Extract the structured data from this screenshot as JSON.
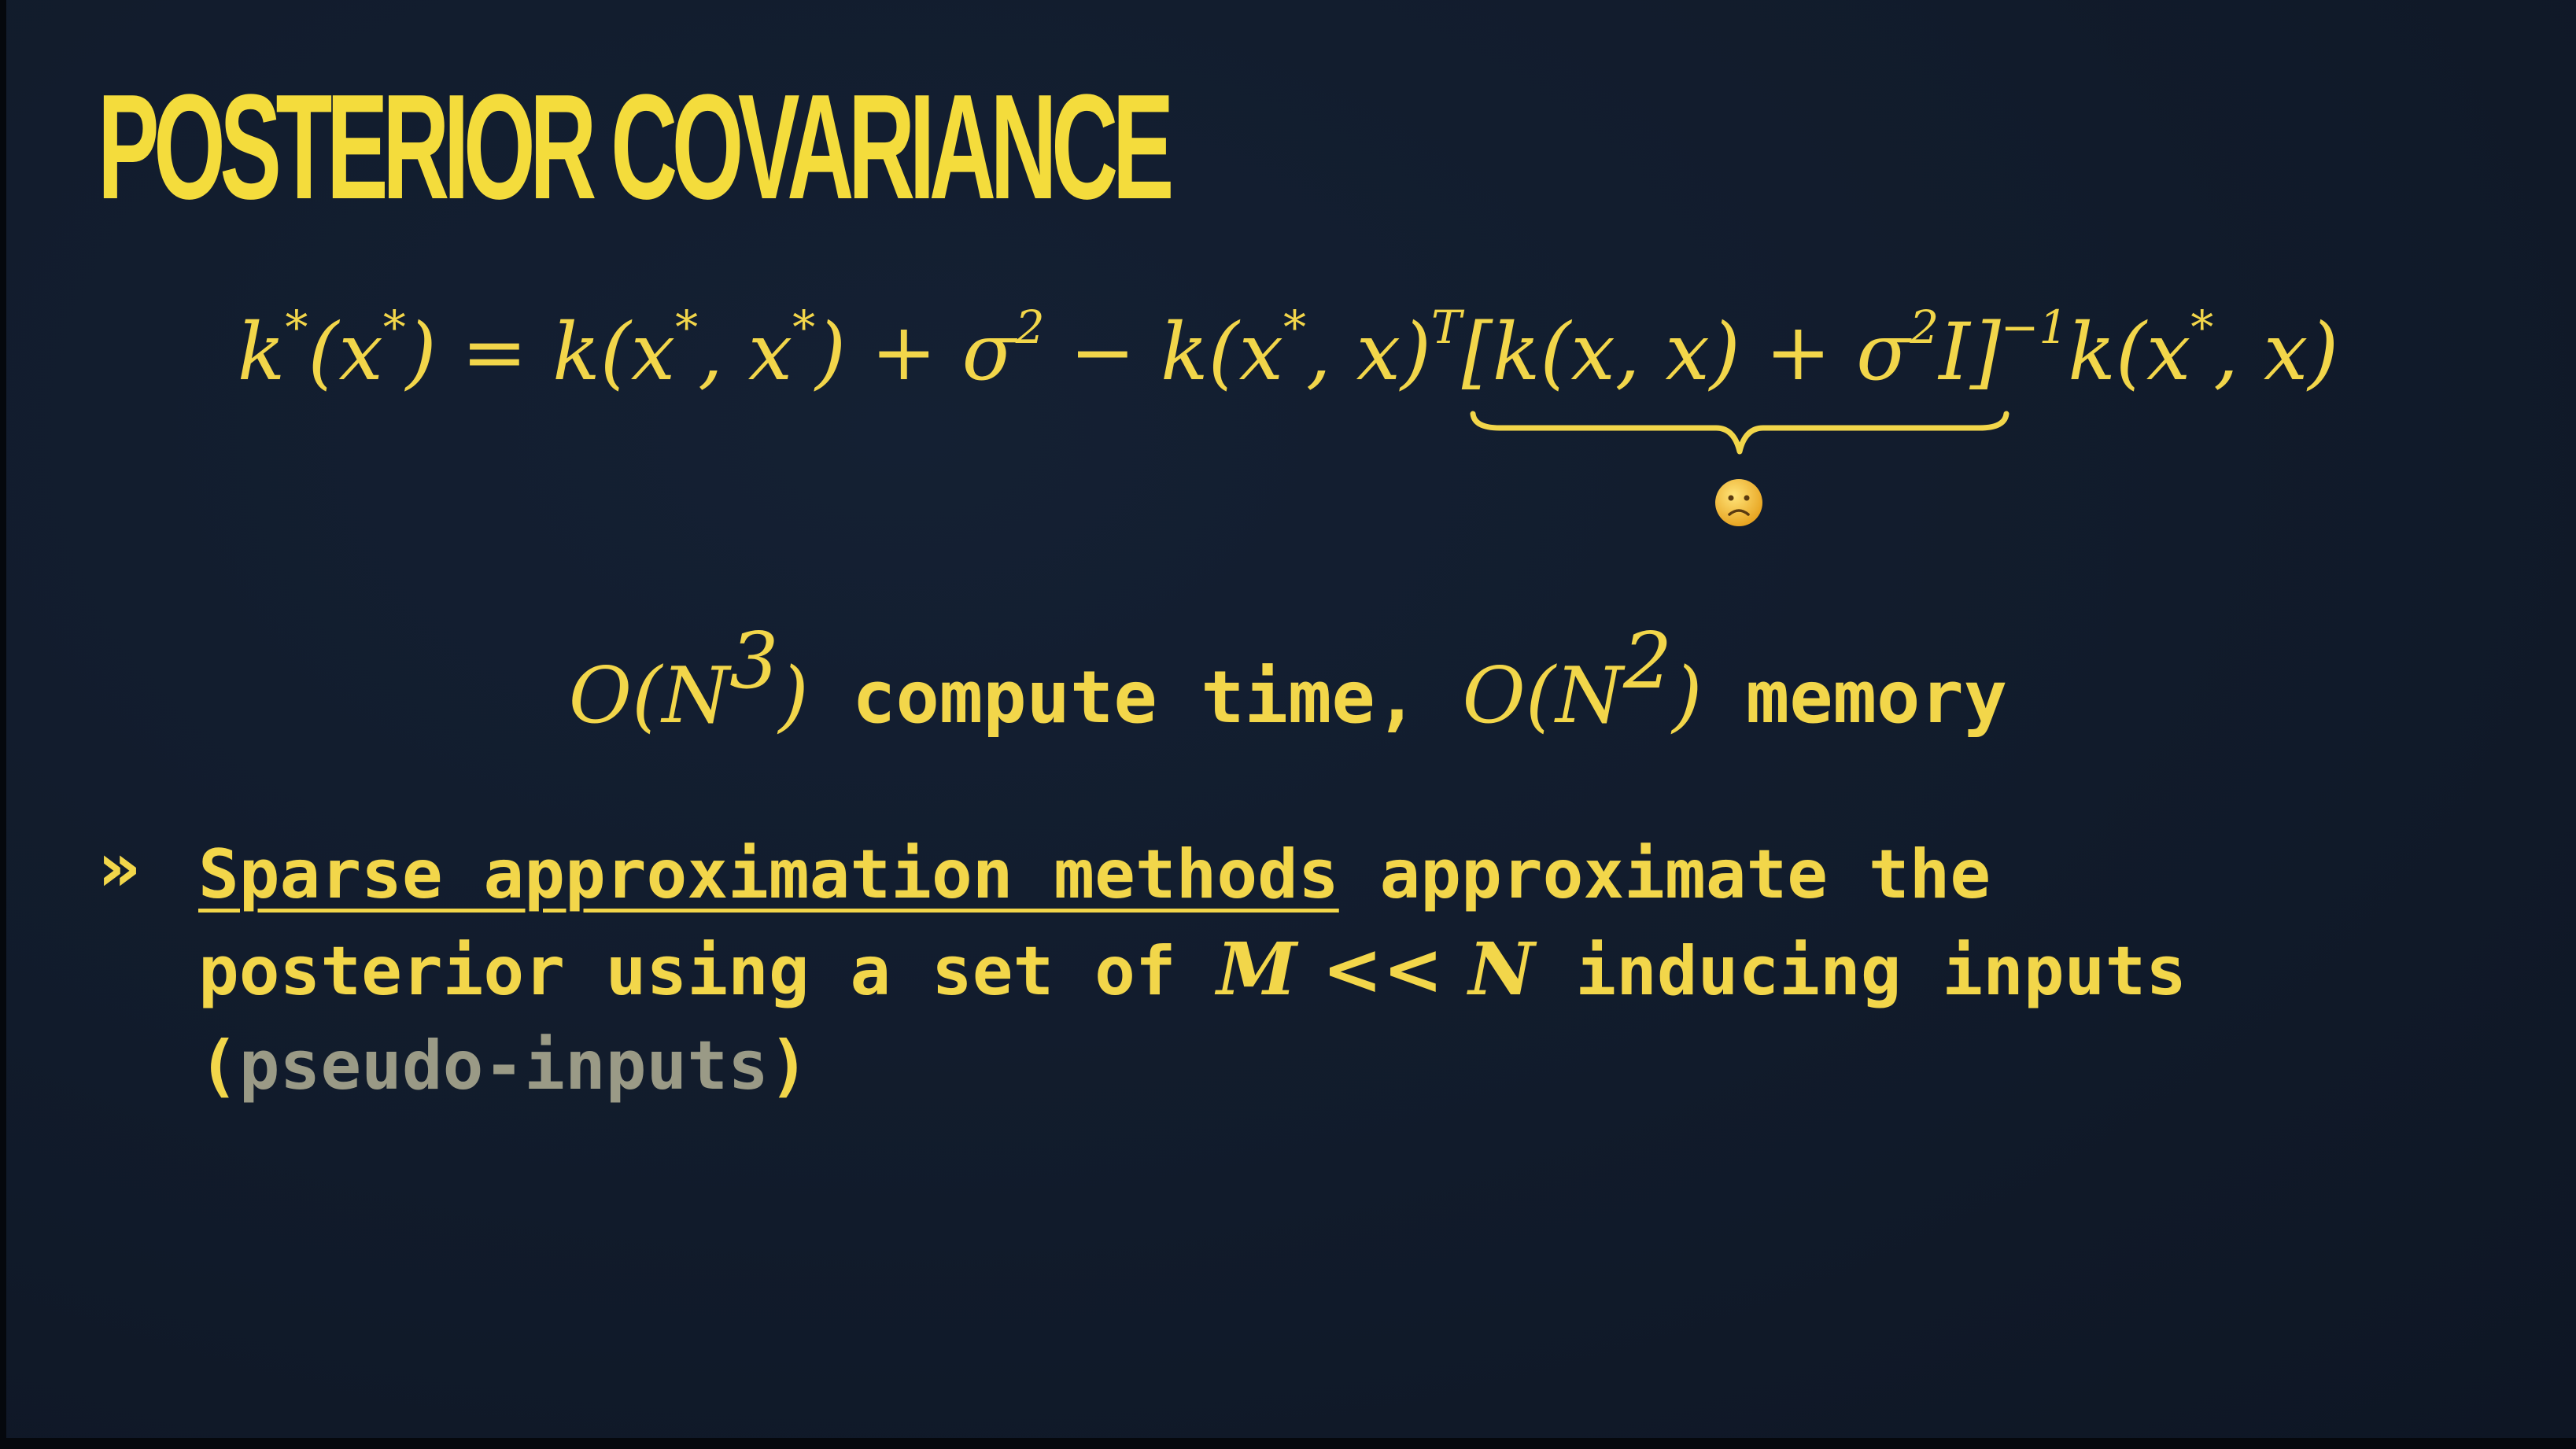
{
  "slide": {
    "title": "POSTERIOR COVARIANCE",
    "formula": {
      "lhs": "k",
      "star": "*",
      "lhs_arg": "(x",
      "eq": ") = k(x",
      "mid1": ", x",
      "mid2": ") + σ",
      "two": "2",
      "minus": " − k(x",
      "comma_x": ", x)",
      "T": "T",
      "bracket": "[k(x, x) + σ",
      "I": "I]",
      "inv": "−1",
      "tail": "k(x",
      "tail_end": ", x)"
    },
    "complexity": {
      "o1": "O(N",
      "e1": "3",
      "c1": ")",
      "text1": " compute time, ",
      "o2": "O(N",
      "e2": "2",
      "c2": ")",
      "text2": " memory"
    },
    "bullet": {
      "marker": "»",
      "link_text": "Sparse approximation methods",
      "line1_rest": " approximate the",
      "line2_pre": "posterior using a set of ",
      "line2_math": "M << N",
      "line2_post": " inducing inputs",
      "paren_open": "(",
      "paren_inner": "pseudo-inputs",
      "paren_close": ")"
    }
  },
  "colors": {
    "background": "#111b2b",
    "accent": "#f2d64a",
    "muted": "#9a9a86"
  },
  "icons": {
    "brace": "underbrace",
    "face": "sad-face-emoji"
  }
}
